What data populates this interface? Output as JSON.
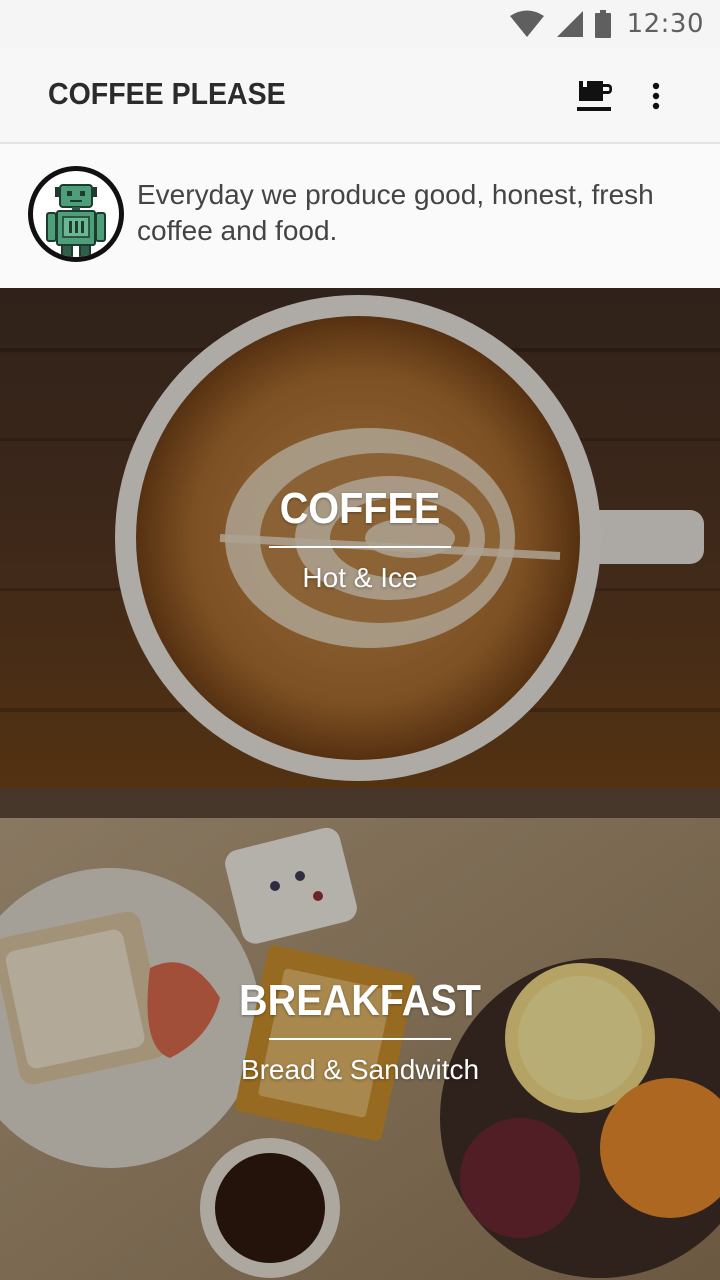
{
  "status_bar": {
    "time": "12:30",
    "icons": [
      "wifi-icon",
      "cell-signal-icon",
      "battery-icon"
    ]
  },
  "toolbar": {
    "title": "COFFEE PLEASE",
    "actions": [
      "coffee-cup-icon",
      "more-vert-icon"
    ]
  },
  "intro": {
    "avatar_icon": "robot-icon",
    "text": "Everyday we produce good, honest, fresh coffee and food."
  },
  "categories": [
    {
      "title": "COFFEE",
      "subtitle": "Hot & Ice",
      "image": "latte-art-photo"
    },
    {
      "title": "BREAKFAST",
      "subtitle": "Bread & Sandwitch",
      "image": "breakfast-table-photo"
    }
  ],
  "colors": {
    "robot_green": "#4e9e7a",
    "robot_dark": "#2f5f4a",
    "toolbar_bg": "#f7f7f7"
  }
}
